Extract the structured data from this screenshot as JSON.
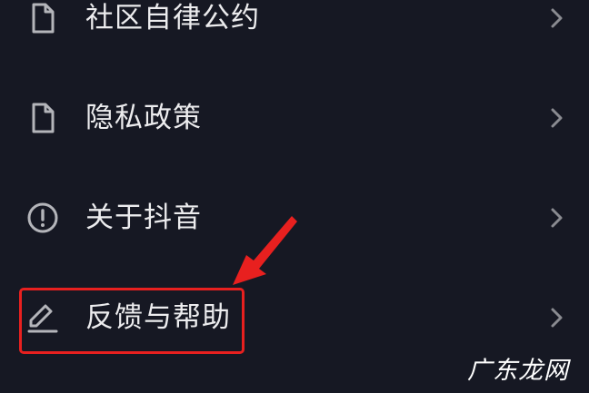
{
  "menu": {
    "items": [
      {
        "label": "社区自律公约",
        "icon": "document-icon"
      },
      {
        "label": "隐私政策",
        "icon": "document-icon"
      },
      {
        "label": "关于抖音",
        "icon": "info-circle-icon"
      },
      {
        "label": "反馈与帮助",
        "icon": "pencil-icon"
      }
    ],
    "chevron_icon": "chevron-right-icon"
  },
  "annotation": {
    "highlighted_item": "反馈与帮助",
    "color": "#e8201f"
  },
  "watermark": {
    "text": "广东龙网"
  },
  "colors": {
    "background": "#161823",
    "text": "#ececee",
    "icon": "#b4b5ba",
    "chevron": "#8a8b91"
  }
}
